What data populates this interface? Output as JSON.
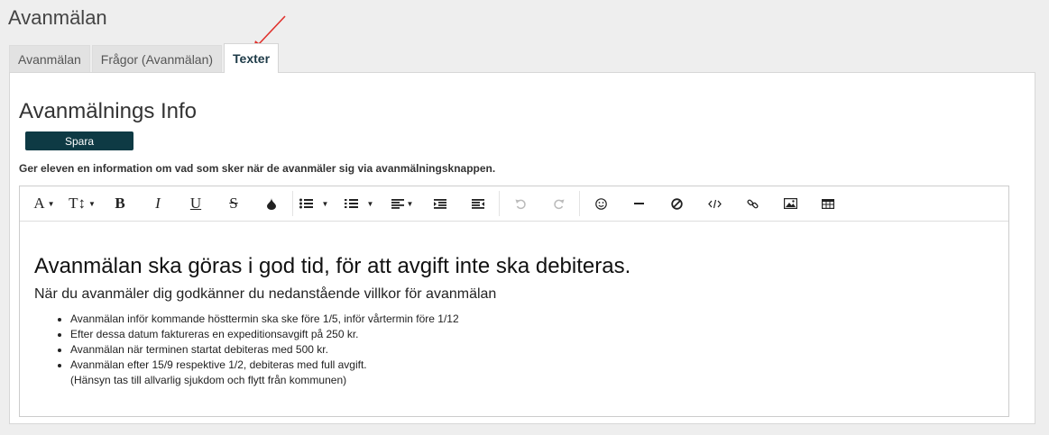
{
  "page": {
    "title": "Avanmälan"
  },
  "tabs": [
    {
      "label": "Avanmälan"
    },
    {
      "label": "Frågor (Avanmälan)"
    },
    {
      "label": "Texter"
    }
  ],
  "section": {
    "title": "Avanmälnings Info",
    "save_label": "Spara",
    "help_text": "Ger eleven en information om vad som sker när de avanmäler sig via avanmälningsknappen."
  },
  "toolbar": {
    "font_label": "A",
    "size_label": "T↕",
    "bold_label": "B",
    "italic_label": "I",
    "underline_label": "U",
    "strike_label": "S"
  },
  "editor": {
    "heading": "Avanmälan ska göras i god tid, för att avgift inte ska debiteras.",
    "intro": "När du avanmäler dig godkänner du nedanstående villkor för avanmälan",
    "items": [
      "Avanmälan inför kommande hösttermin ska ske före 1/5, inför vårtermin före 1/12",
      "Efter dessa datum faktureras en expeditionsavgift på 250 kr.",
      "Avanmälan när terminen startat debiteras med 500 kr.",
      "Avanmälan efter 15/9 respektive 1/2, debiteras med full avgift."
    ],
    "item_note": "(Hänsyn tas till allvarlig sjukdom och flytt från kommunen)"
  },
  "colors": {
    "accent": "#0e3a44",
    "annotation_arrow": "#e0302b",
    "background": "#eeeeee"
  }
}
